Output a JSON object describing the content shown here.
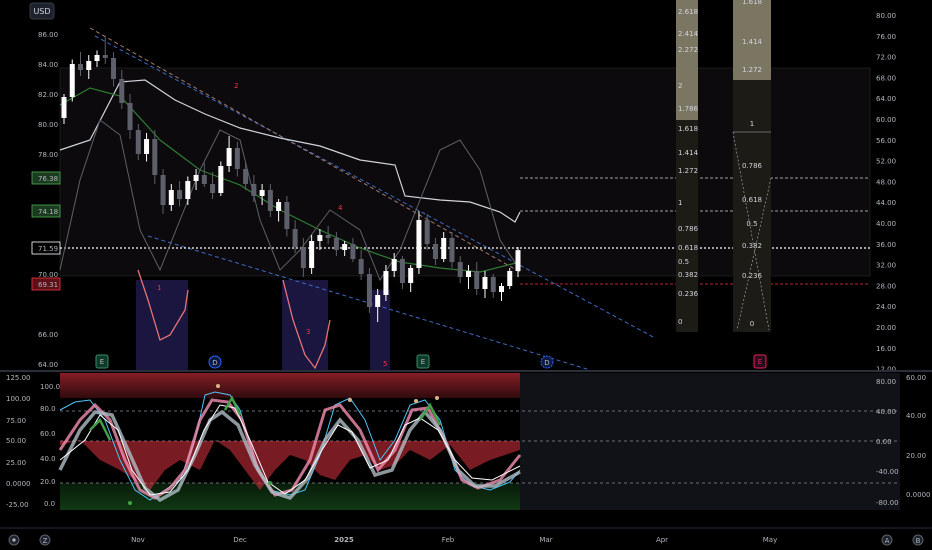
{
  "header": {
    "currency": "USD"
  },
  "left_axis": {
    "ticks": [
      "86.00",
      "84.00",
      "82.00",
      "80.00",
      "78.00",
      "76.38",
      "74.18",
      "71.59",
      "70.00",
      "69.31",
      "66.00",
      "64.00"
    ],
    "badges": [
      {
        "text": "76.38",
        "color": "#4caf50"
      },
      {
        "text": "74.18",
        "color": "#4caf50"
      },
      {
        "text": "71.59",
        "color": "#ffffff"
      },
      {
        "text": "69.31",
        "color": "#f23645"
      }
    ]
  },
  "right_axis": {
    "ticks": [
      "80.00",
      "76.00",
      "72.00",
      "68.00",
      "64.00",
      "60.00",
      "56.00",
      "52.00",
      "48.00",
      "44.00",
      "40.00",
      "36.00",
      "32.00",
      "28.00",
      "24.00",
      "20.00",
      "16.00",
      "12.00"
    ]
  },
  "fib_panel_1": {
    "levels": [
      "2.618",
      "2.414",
      "2.272",
      "2",
      "1.786",
      "1.618",
      "1.414",
      "1.272",
      "1",
      "0.786",
      "0.618",
      "0.5",
      "0.382",
      "0.236",
      "0"
    ]
  },
  "fib_panel_2": {
    "levels": [
      "1.618",
      "1.414",
      "1.272",
      "1",
      "0.786",
      "0.618",
      "0.5",
      "0.382",
      "0.236",
      "0"
    ]
  },
  "wave_labels": [
    "1",
    "2",
    "3",
    "4",
    "5"
  ],
  "event_markers": [
    "E",
    "D",
    "E",
    "D",
    "E"
  ],
  "osc": {
    "left_ticks": [
      "125.00",
      "100.0",
      "100.00",
      "80.0",
      "75.00",
      "60.0",
      "50.00",
      "40.0",
      "25.00",
      "20.0",
      "0.0000",
      "0.0",
      "-25.00"
    ],
    "right_inner_ticks": [
      "80.00",
      "40.00",
      "0.00",
      "-40.00",
      "-80.00"
    ],
    "right_outer_ticks": [
      "60.00",
      "40.00",
      "20.00",
      "0.0000"
    ]
  },
  "x_axis": {
    "labels": [
      "Nov",
      "Dec",
      "2025",
      "Feb",
      "Mar",
      "Apr",
      "May"
    ]
  },
  "corner_icons": {
    "bottom_left": [
      "gear-icon",
      "z-icon"
    ],
    "bottom_right": [
      "auto-icon",
      "b-icon"
    ]
  },
  "colors": {
    "up": "#ffffff",
    "down": "#5d606b",
    "wave_label": "#f23645",
    "fib_bar": "#8c8670",
    "event_blue": "#2962ff",
    "event_pink": "#e91e63"
  },
  "chart_data": {
    "type": "candlestick",
    "price_range": [
      64,
      86
    ],
    "last_price": 71.59,
    "candles": [
      [
        80.4,
        82.0,
        80.0,
        81.8
      ],
      [
        81.8,
        84.3,
        81.5,
        84.0
      ],
      [
        84.0,
        84.8,
        83.2,
        83.6
      ],
      [
        83.6,
        84.6,
        83.0,
        84.2
      ],
      [
        84.2,
        84.9,
        83.8,
        84.6
      ],
      [
        84.6,
        85.9,
        84.0,
        84.4
      ],
      [
        84.4,
        84.8,
        82.5,
        83.0
      ],
      [
        83.0,
        83.6,
        81.0,
        81.4
      ],
      [
        81.4,
        82.0,
        79.0,
        79.6
      ],
      [
        79.6,
        80.0,
        77.6,
        78.0
      ],
      [
        78.0,
        79.4,
        77.5,
        79.0
      ],
      [
        79.0,
        79.6,
        76.0,
        76.6
      ],
      [
        76.6,
        77.0,
        74.0,
        74.6
      ],
      [
        74.6,
        76.0,
        74.2,
        75.6
      ],
      [
        75.6,
        76.2,
        74.5,
        75.0
      ],
      [
        75.0,
        76.5,
        74.6,
        76.2
      ],
      [
        76.2,
        77.0,
        75.6,
        76.6
      ],
      [
        76.6,
        77.4,
        75.8,
        76.0
      ],
      [
        76.0,
        76.8,
        75.0,
        75.4
      ],
      [
        75.4,
        77.5,
        75.2,
        77.2
      ],
      [
        77.2,
        79.2,
        76.8,
        78.4
      ],
      [
        78.4,
        78.8,
        76.5,
        77.0
      ],
      [
        77.0,
        77.4,
        75.6,
        76.0
      ],
      [
        76.0,
        76.6,
        74.8,
        75.2
      ],
      [
        75.2,
        76.0,
        74.6,
        75.6
      ],
      [
        75.6,
        76.0,
        73.8,
        74.2
      ],
      [
        74.2,
        75.0,
        73.5,
        74.8
      ],
      [
        74.8,
        75.2,
        72.5,
        73.0
      ],
      [
        73.0,
        73.6,
        71.4,
        71.8
      ],
      [
        71.8,
        72.4,
        69.8,
        70.4
      ],
      [
        70.4,
        72.6,
        70.0,
        72.2
      ],
      [
        72.2,
        73.0,
        71.6,
        72.6
      ],
      [
        72.6,
        73.2,
        72.0,
        72.4
      ],
      [
        72.4,
        72.8,
        71.2,
        71.6
      ],
      [
        71.6,
        72.2,
        71.2,
        72.0
      ],
      [
        72.0,
        72.4,
        70.8,
        71.0
      ],
      [
        71.0,
        71.6,
        69.6,
        70.0
      ],
      [
        70.0,
        70.4,
        67.4,
        67.8
      ],
      [
        67.8,
        69.0,
        66.8,
        68.6
      ],
      [
        68.6,
        70.6,
        68.2,
        70.2
      ],
      [
        70.2,
        71.4,
        69.8,
        71.0
      ],
      [
        71.0,
        71.2,
        69.0,
        69.4
      ],
      [
        69.4,
        70.6,
        68.8,
        70.4
      ],
      [
        70.4,
        74.2,
        70.0,
        73.6
      ],
      [
        73.6,
        74.0,
        71.6,
        72.0
      ],
      [
        72.0,
        72.4,
        70.6,
        71.0
      ],
      [
        71.0,
        72.8,
        70.8,
        72.4
      ],
      [
        72.4,
        72.8,
        70.4,
        70.8
      ],
      [
        70.8,
        71.2,
        69.4,
        69.8
      ],
      [
        69.8,
        70.6,
        69.0,
        70.2
      ],
      [
        70.2,
        70.8,
        68.6,
        69.0
      ],
      [
        69.0,
        70.2,
        68.4,
        69.8
      ],
      [
        69.8,
        70.0,
        68.4,
        68.8
      ],
      [
        68.8,
        69.4,
        68.2,
        69.2
      ],
      [
        69.2,
        70.4,
        69.0,
        70.2
      ],
      [
        70.2,
        71.8,
        69.8,
        71.59
      ]
    ]
  }
}
